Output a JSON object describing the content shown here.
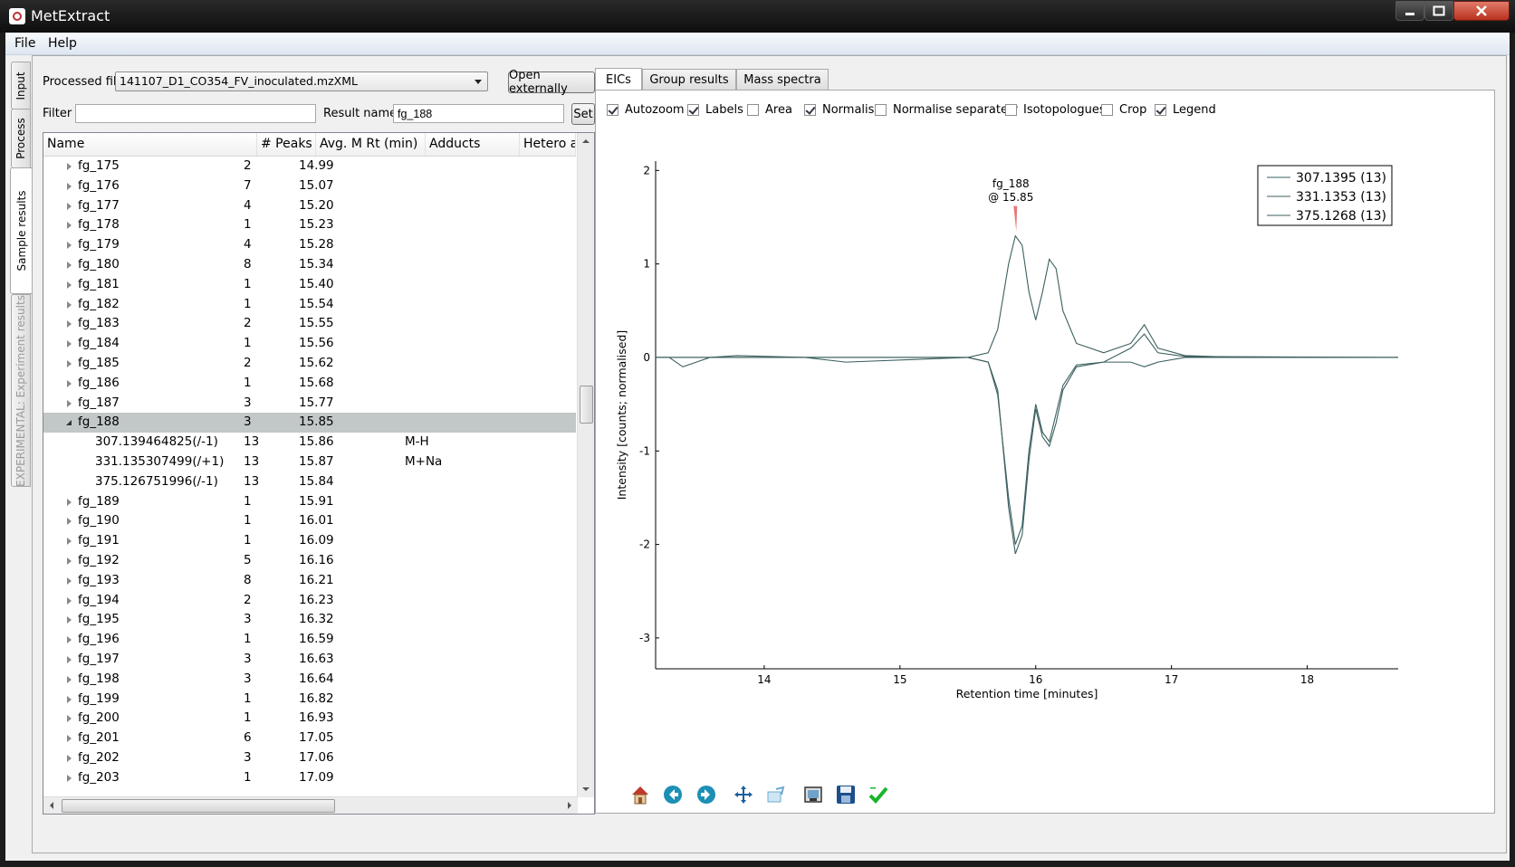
{
  "window": {
    "title": "MetExtract"
  },
  "menu": [
    "File",
    "Help"
  ],
  "side_tabs": [
    "Input",
    "Process",
    "Sample results",
    "EXPERIMENTAL: Experiment results"
  ],
  "processed_file": {
    "label": "Processed file",
    "value": "141107_D1_CO354_FV_inoculated.mzXML",
    "open_button": "Open externally"
  },
  "filter": {
    "label": "Filter",
    "value": ""
  },
  "result_name": {
    "label": "Result name",
    "value": "fg_188",
    "set_button": "Set"
  },
  "tree": {
    "columns": [
      "Name",
      "# Peaks",
      "Avg. M Rt (min)",
      "Adducts",
      "Hetero a"
    ],
    "rows": [
      {
        "name": "fg_175",
        "peaks": "2",
        "rt": "14.99",
        "adducts": "",
        "type": "group"
      },
      {
        "name": "fg_176",
        "peaks": "7",
        "rt": "15.07",
        "adducts": "",
        "type": "group"
      },
      {
        "name": "fg_177",
        "peaks": "4",
        "rt": "15.20",
        "adducts": "",
        "type": "group"
      },
      {
        "name": "fg_178",
        "peaks": "1",
        "rt": "15.23",
        "adducts": "",
        "type": "group"
      },
      {
        "name": "fg_179",
        "peaks": "4",
        "rt": "15.28",
        "adducts": "",
        "type": "group"
      },
      {
        "name": "fg_180",
        "peaks": "8",
        "rt": "15.34",
        "adducts": "",
        "type": "group"
      },
      {
        "name": "fg_181",
        "peaks": "1",
        "rt": "15.40",
        "adducts": "",
        "type": "group"
      },
      {
        "name": "fg_182",
        "peaks": "1",
        "rt": "15.54",
        "adducts": "",
        "type": "group"
      },
      {
        "name": "fg_183",
        "peaks": "2",
        "rt": "15.55",
        "adducts": "",
        "type": "group"
      },
      {
        "name": "fg_184",
        "peaks": "1",
        "rt": "15.56",
        "adducts": "",
        "type": "group"
      },
      {
        "name": "fg_185",
        "peaks": "2",
        "rt": "15.62",
        "adducts": "",
        "type": "group"
      },
      {
        "name": "fg_186",
        "peaks": "1",
        "rt": "15.68",
        "adducts": "",
        "type": "group"
      },
      {
        "name": "fg_187",
        "peaks": "3",
        "rt": "15.77",
        "adducts": "",
        "type": "group"
      },
      {
        "name": "fg_188",
        "peaks": "3",
        "rt": "15.85",
        "adducts": "",
        "type": "open"
      },
      {
        "name": "307.139464825(/-1)",
        "peaks": "13",
        "rt": "15.86",
        "adducts": "M-H",
        "type": "child"
      },
      {
        "name": "331.135307499(/+1)",
        "peaks": "13",
        "rt": "15.87",
        "adducts": "M+Na",
        "type": "child"
      },
      {
        "name": "375.126751996(/-1)",
        "peaks": "13",
        "rt": "15.84",
        "adducts": "",
        "type": "child"
      },
      {
        "name": "fg_189",
        "peaks": "1",
        "rt": "15.91",
        "adducts": "",
        "type": "group"
      },
      {
        "name": "fg_190",
        "peaks": "1",
        "rt": "16.01",
        "adducts": "",
        "type": "group"
      },
      {
        "name": "fg_191",
        "peaks": "1",
        "rt": "16.09",
        "adducts": "",
        "type": "group"
      },
      {
        "name": "fg_192",
        "peaks": "5",
        "rt": "16.16",
        "adducts": "",
        "type": "group"
      },
      {
        "name": "fg_193",
        "peaks": "8",
        "rt": "16.21",
        "adducts": "",
        "type": "group"
      },
      {
        "name": "fg_194",
        "peaks": "2",
        "rt": "16.23",
        "adducts": "",
        "type": "group"
      },
      {
        "name": "fg_195",
        "peaks": "3",
        "rt": "16.32",
        "adducts": "",
        "type": "group"
      },
      {
        "name": "fg_196",
        "peaks": "1",
        "rt": "16.59",
        "adducts": "",
        "type": "group"
      },
      {
        "name": "fg_197",
        "peaks": "3",
        "rt": "16.63",
        "adducts": "",
        "type": "group"
      },
      {
        "name": "fg_198",
        "peaks": "3",
        "rt": "16.64",
        "adducts": "",
        "type": "group"
      },
      {
        "name": "fg_199",
        "peaks": "1",
        "rt": "16.82",
        "adducts": "",
        "type": "group"
      },
      {
        "name": "fg_200",
        "peaks": "1",
        "rt": "16.93",
        "adducts": "",
        "type": "group"
      },
      {
        "name": "fg_201",
        "peaks": "6",
        "rt": "17.05",
        "adducts": "",
        "type": "group"
      },
      {
        "name": "fg_202",
        "peaks": "3",
        "rt": "17.06",
        "adducts": "",
        "type": "group"
      },
      {
        "name": "fg_203",
        "peaks": "1",
        "rt": "17.09",
        "adducts": "",
        "type": "group"
      }
    ],
    "selected": "fg_188"
  },
  "tabs": [
    "EICs",
    "Group results",
    "Mass spectra"
  ],
  "active_tab": "EICs",
  "options": [
    {
      "label": "Autozoom",
      "checked": true
    },
    {
      "label": "Labels",
      "checked": true
    },
    {
      "label": "Area",
      "checked": false
    },
    {
      "label": "Normalise",
      "checked": true
    },
    {
      "label": "Normalise separately",
      "checked": false
    },
    {
      "label": "Isotopologues",
      "checked": false
    },
    {
      "label": "Crop",
      "checked": false
    },
    {
      "label": "Legend",
      "checked": true
    }
  ],
  "chart_data": {
    "type": "line",
    "xlabel": "Retention time [minutes]",
    "ylabel": "Intensity [counts; normalised]",
    "xlim": [
      13.2,
      18.67
    ],
    "ylim": [
      -3.33,
      2.1
    ],
    "xticks": [
      14,
      15,
      16,
      17,
      18
    ],
    "yticks": [
      2,
      1,
      0,
      -1,
      -2,
      -3
    ],
    "annotation": {
      "text_line1": "fg_188",
      "text_line2": "@ 15.85",
      "x": 15.85,
      "marker_color": "#e8787a"
    },
    "legend": [
      "307.1395 (13)",
      "331.1353 (13)",
      "375.1268 (13)"
    ],
    "legend_position": "top-right",
    "series_color": "#3c5f5f",
    "series": [
      {
        "name": "307.1395 (13)",
        "x": [
          13.2,
          13.3,
          13.4,
          13.5,
          13.6,
          13.8,
          14.3,
          14.6,
          15.5,
          15.65,
          15.72,
          15.8,
          15.85,
          15.9,
          15.95,
          16.0,
          16.05,
          16.1,
          16.15,
          16.2,
          16.3,
          16.5,
          16.7,
          16.8,
          16.9,
          17.1,
          17.5,
          18.67
        ],
        "y": [
          0,
          0,
          -0.1,
          -0.05,
          0,
          0.02,
          0,
          -0.05,
          0,
          0.05,
          0.3,
          1.0,
          1.3,
          1.2,
          0.7,
          0.4,
          0.7,
          1.05,
          0.95,
          0.5,
          0.15,
          0.05,
          0.15,
          0.35,
          0.1,
          0.02,
          0,
          0
        ]
      },
      {
        "name": "331.1353 (13)",
        "x": [
          13.2,
          15.5,
          15.65,
          15.72,
          15.8,
          15.85,
          15.9,
          15.95,
          16.0,
          16.05,
          16.1,
          16.15,
          16.2,
          16.3,
          16.5,
          16.7,
          16.8,
          16.9,
          17.1,
          18.67
        ],
        "y": [
          0,
          0,
          -0.05,
          -0.4,
          -1.5,
          -2.0,
          -1.8,
          -1.0,
          -0.5,
          -0.8,
          -0.9,
          -0.6,
          -0.3,
          -0.08,
          -0.05,
          0.1,
          0.25,
          0.05,
          0.01,
          0
        ]
      },
      {
        "name": "375.1268 (13)",
        "x": [
          13.2,
          15.5,
          15.65,
          15.72,
          15.8,
          15.85,
          15.9,
          15.95,
          16.0,
          16.05,
          16.1,
          16.15,
          16.2,
          16.3,
          16.5,
          16.7,
          16.8,
          16.9,
          17.1,
          18.67
        ],
        "y": [
          0,
          0,
          -0.05,
          -0.35,
          -1.6,
          -2.1,
          -1.9,
          -1.1,
          -0.55,
          -0.85,
          -0.95,
          -0.7,
          -0.35,
          -0.1,
          -0.05,
          -0.05,
          -0.1,
          -0.05,
          0,
          0
        ]
      }
    ]
  },
  "toolbar_icons": [
    "home-icon",
    "back-icon",
    "forward-icon",
    "pan-icon",
    "zoom-icon",
    "subplots-icon",
    "save-icon",
    "check-icon"
  ]
}
